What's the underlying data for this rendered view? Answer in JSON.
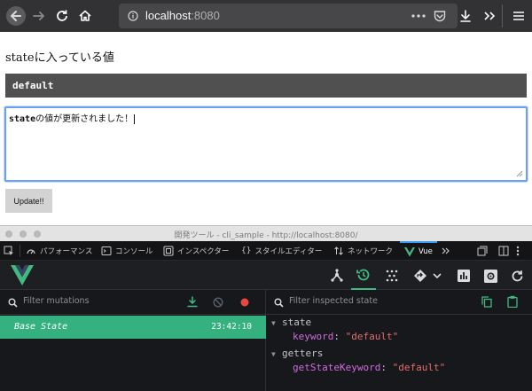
{
  "browser": {
    "url_host": "localhost",
    "url_port": ":8080",
    "icons": [
      "back-arrow-icon",
      "forward-arrow-icon",
      "reload-icon",
      "home-icon",
      "info-icon",
      "ellipsis-icon",
      "pocket-icon",
      "download-icon",
      "overflow-icon",
      "hamburger-menu-icon"
    ]
  },
  "page": {
    "heading": "stateに入っている値",
    "state_value": "default",
    "textarea_bold": "state",
    "textarea_rest": "の値が更新されました！",
    "update_label": "Update!!"
  },
  "devtools": {
    "title": "開発ツール - cli_sample - http://localhost:8080/",
    "tabs": [
      {
        "label": "パフォーマンス"
      },
      {
        "label": "コンソール"
      },
      {
        "label": "インスペクター"
      },
      {
        "label": "スタイルエディター"
      },
      {
        "label": "ネットワーク"
      },
      {
        "label": "Vue"
      }
    ]
  },
  "vue": {
    "filter_mutations_placeholder": "Filter mutations",
    "filter_state_placeholder": "Filter inspected state",
    "base_state_label": "Base State",
    "base_state_time": "23:42:10",
    "state_section": "state",
    "state_key": "keyword",
    "state_value": "\"default\"",
    "getters_section": "getters",
    "getter_key": "getStateKeyword",
    "getter_value": "\"default\"",
    "accent_color": "#42b983",
    "record_color": "#e8483f"
  }
}
